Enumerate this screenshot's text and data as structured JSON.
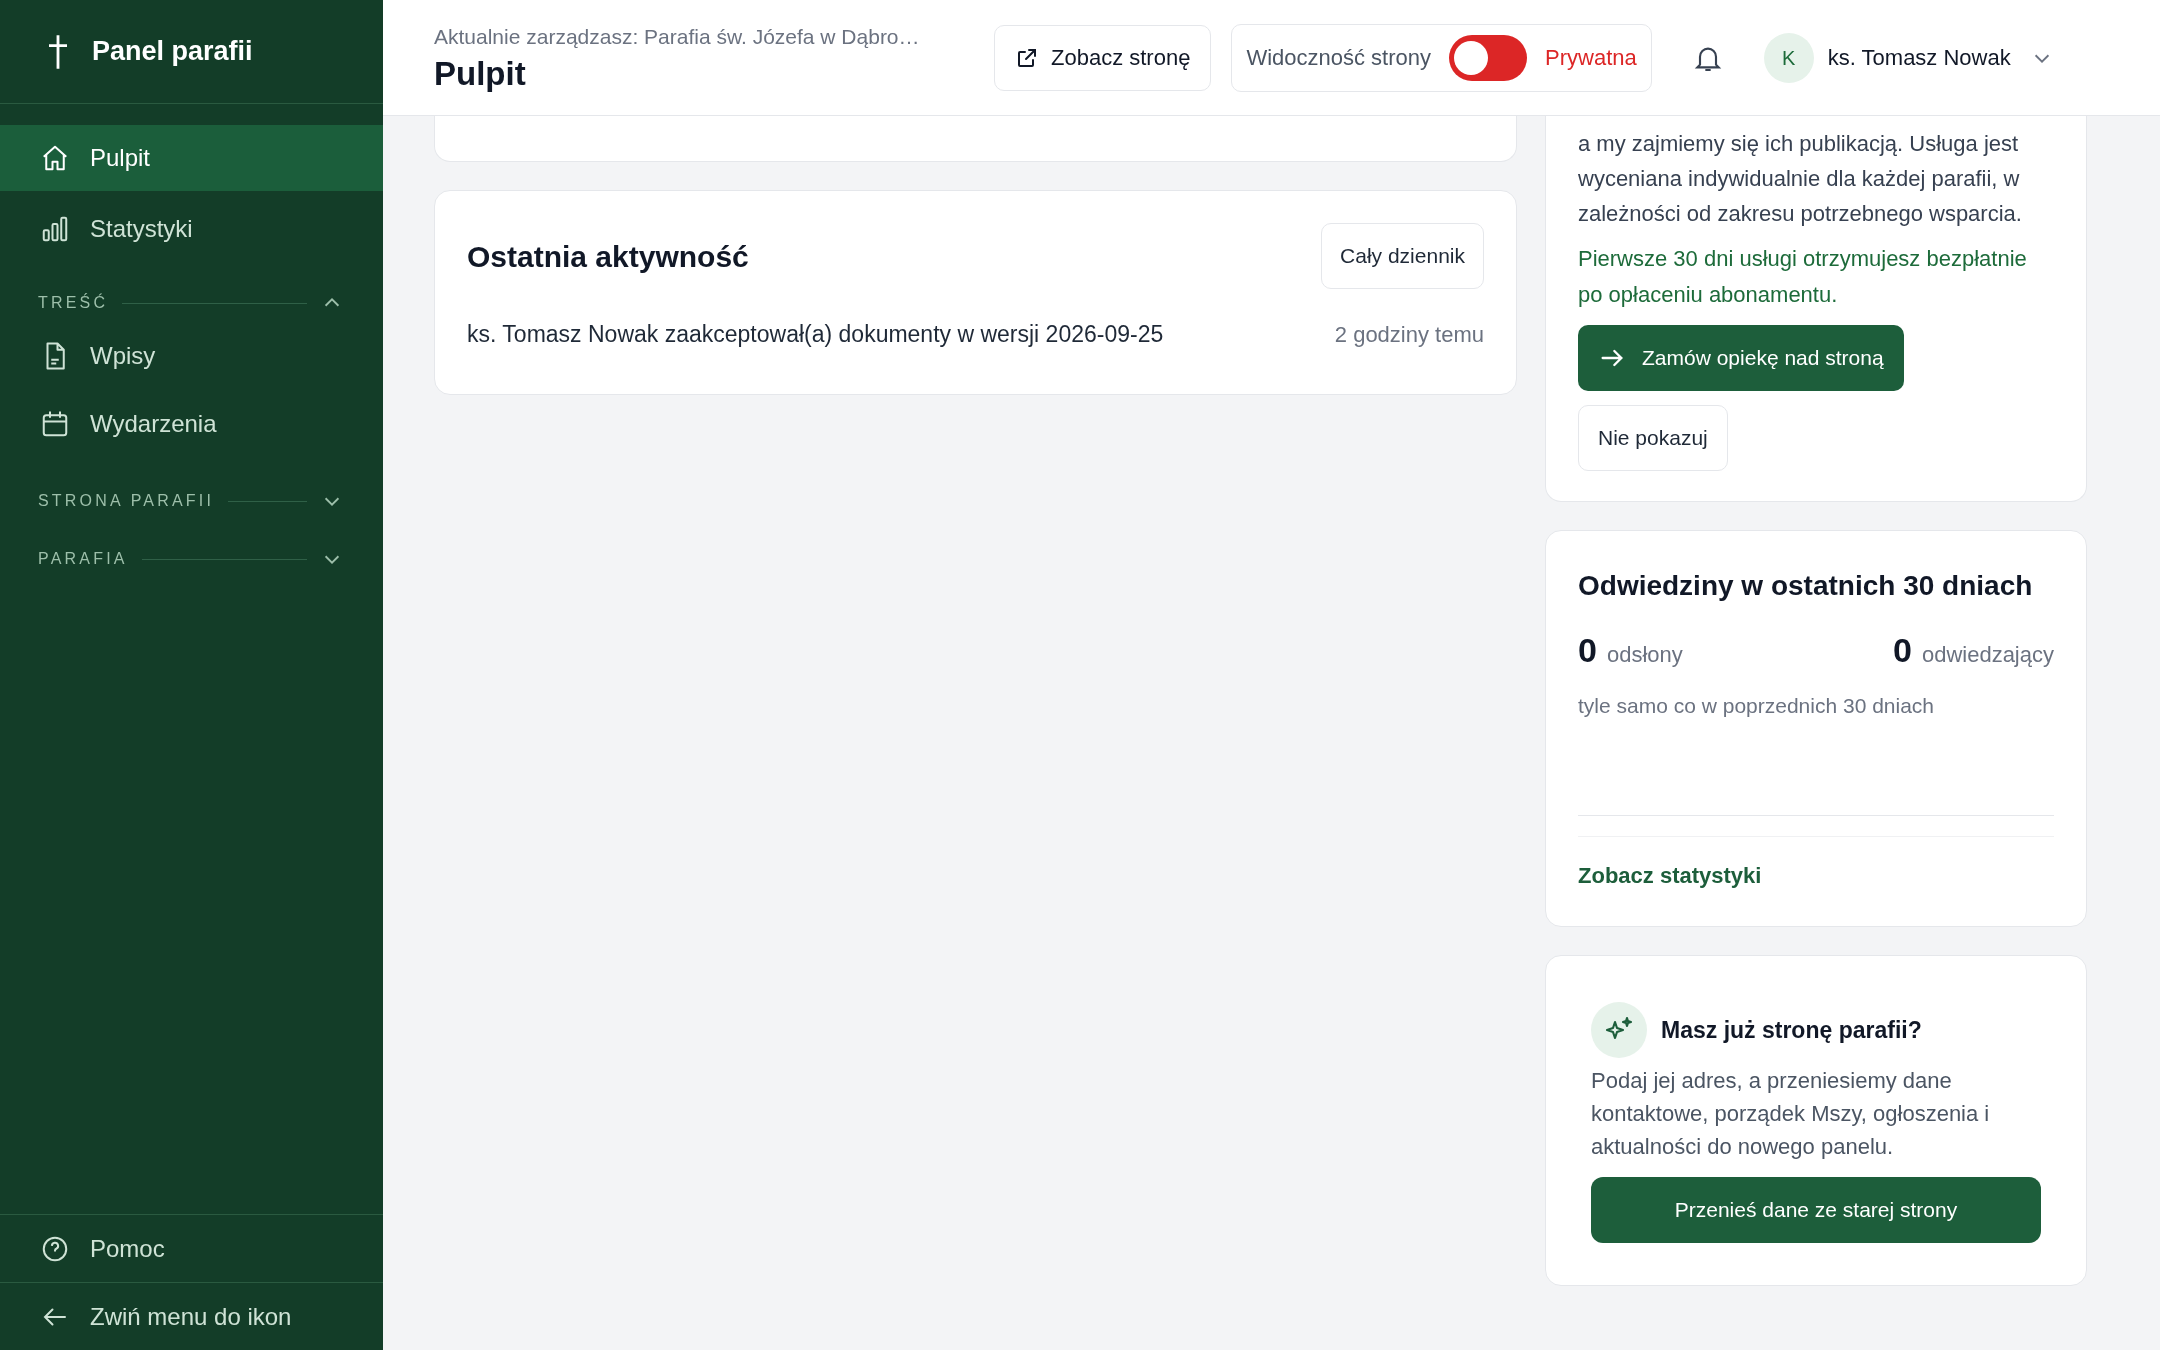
{
  "sidebar": {
    "title": "Panel parafii",
    "items": [
      {
        "label": "Pulpit",
        "selected": true
      },
      {
        "label": "Statystyki",
        "selected": false
      }
    ],
    "sections": [
      {
        "label": "TREŚĆ",
        "expanded": true,
        "items": [
          {
            "label": "Wpisy",
            "selected": false
          },
          {
            "label": "Wydarzenia",
            "selected": false
          }
        ]
      },
      {
        "label": "STRONA PARAFII",
        "expanded": false
      },
      {
        "label": "PARAFIA",
        "expanded": false
      }
    ],
    "footer": [
      "Pomoc",
      "Zwiń menu do ikon"
    ]
  },
  "header": {
    "context": "Aktualnie zarządzasz: Parafia św. Józefa w Dąbro…",
    "title": "Pulpit",
    "view_button": "Zobacz stronę",
    "visibility": {
      "label": "Widoczność strony",
      "on": false,
      "state_text": "Prywatna"
    },
    "user": {
      "initial": "K",
      "name": "ks. Tomasz Nowak"
    }
  },
  "activity": {
    "title": "Ostatnia aktywność",
    "button": "Cały dziennik",
    "entries": [
      {
        "text": "ks. Tomasz Nowak zaakceptował(a) dokumenty w wersji 2026-09-25",
        "time": "2 godziny temu"
      }
    ]
  },
  "care_card": {
    "description": "a my zajmiemy się ich publikacją. Usługa jest wyceniana indywidualnie dla każdej parafii, w zależności od zakresu potrzebnego wsparcia.",
    "promo": "Pierwsze 30 dni usługi otrzymujesz bezpłatnie po opłaceniu abonamentu.",
    "primary_button": "Zamów opiekę nad stroną",
    "secondary_button": "Nie pokazuj"
  },
  "visits": {
    "title": "Odwiedziny w ostatnich 30 dniach",
    "stats": [
      {
        "value": "0",
        "label": "odsłony"
      },
      {
        "value": "0",
        "label": "odwiedzający"
      }
    ],
    "comparison": "tyle samo co w poprzednich 30 dniach",
    "link": "Zobacz statystyki"
  },
  "migration": {
    "title": "Masz już stronę parafii?",
    "description": "Podaj jej adres, a przeniesiemy dane kontaktowe, porządek Mszy, ogłoszenia i aktualności do nowego panelu.",
    "button": "Przenieś dane ze starej strony"
  }
}
